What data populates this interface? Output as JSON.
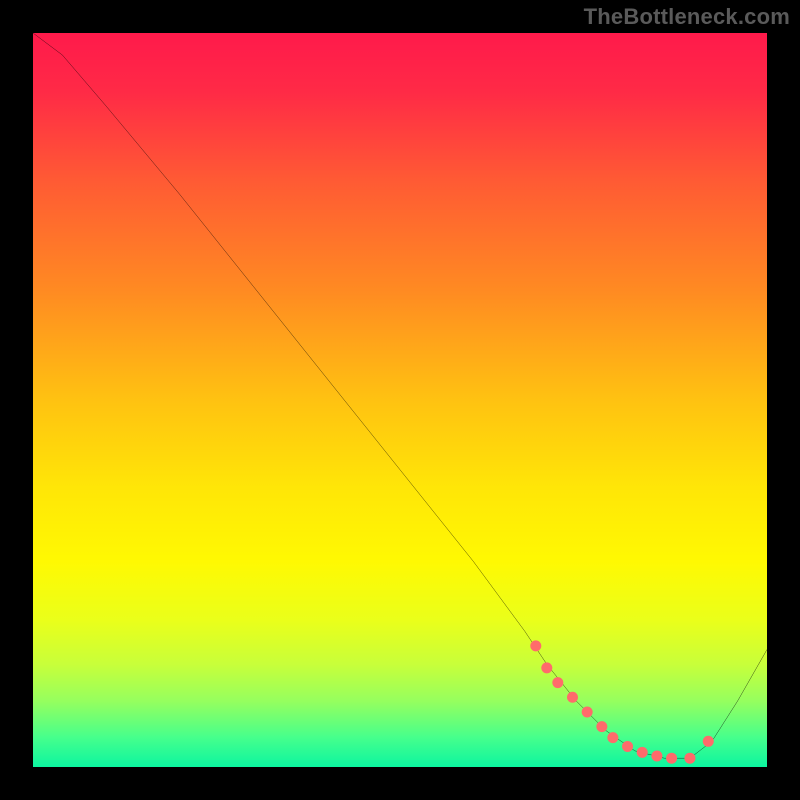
{
  "watermark": "TheBottleneck.com",
  "chart_data": {
    "type": "line",
    "title": "",
    "xlabel": "",
    "ylabel": "",
    "xlim": [
      0,
      100
    ],
    "ylim": [
      0,
      100
    ],
    "grid": false,
    "legend": false,
    "background_gradient_stops": [
      {
        "offset": 0.0,
        "color": "#ff1a4b"
      },
      {
        "offset": 0.08,
        "color": "#ff2a46"
      },
      {
        "offset": 0.2,
        "color": "#ff5a34"
      },
      {
        "offset": 0.35,
        "color": "#ff8a22"
      },
      {
        "offset": 0.5,
        "color": "#ffc211"
      },
      {
        "offset": 0.62,
        "color": "#ffe607"
      },
      {
        "offset": 0.72,
        "color": "#fff902"
      },
      {
        "offset": 0.8,
        "color": "#eaff1a"
      },
      {
        "offset": 0.86,
        "color": "#c8ff3a"
      },
      {
        "offset": 0.91,
        "color": "#96ff5e"
      },
      {
        "offset": 0.96,
        "color": "#46ff8c"
      },
      {
        "offset": 1.0,
        "color": "#0cf5a0"
      }
    ],
    "series": [
      {
        "name": "curve",
        "style": "line",
        "color": "#000000",
        "width": 2,
        "x": [
          0,
          4,
          7,
          10,
          20,
          30,
          40,
          50,
          60,
          67,
          70,
          74,
          78,
          82,
          86,
          89.5,
          92.5,
          96,
          100
        ],
        "values": [
          100,
          97,
          93.5,
          90,
          78,
          65.5,
          53,
          40.5,
          28,
          18.5,
          14,
          9,
          5,
          2.2,
          1.2,
          1.2,
          3.5,
          9,
          16
        ]
      },
      {
        "name": "dots",
        "style": "scatter",
        "color": "#ff6b6b",
        "radius": 5.5,
        "x": [
          68.5,
          70,
          71.5,
          73.5,
          75.5,
          77.5,
          79,
          81,
          83,
          85,
          87,
          89.5,
          92
        ],
        "values": [
          16.5,
          13.5,
          11.5,
          9.5,
          7.5,
          5.5,
          4,
          2.8,
          2,
          1.5,
          1.2,
          1.2,
          3.5
        ]
      }
    ]
  }
}
